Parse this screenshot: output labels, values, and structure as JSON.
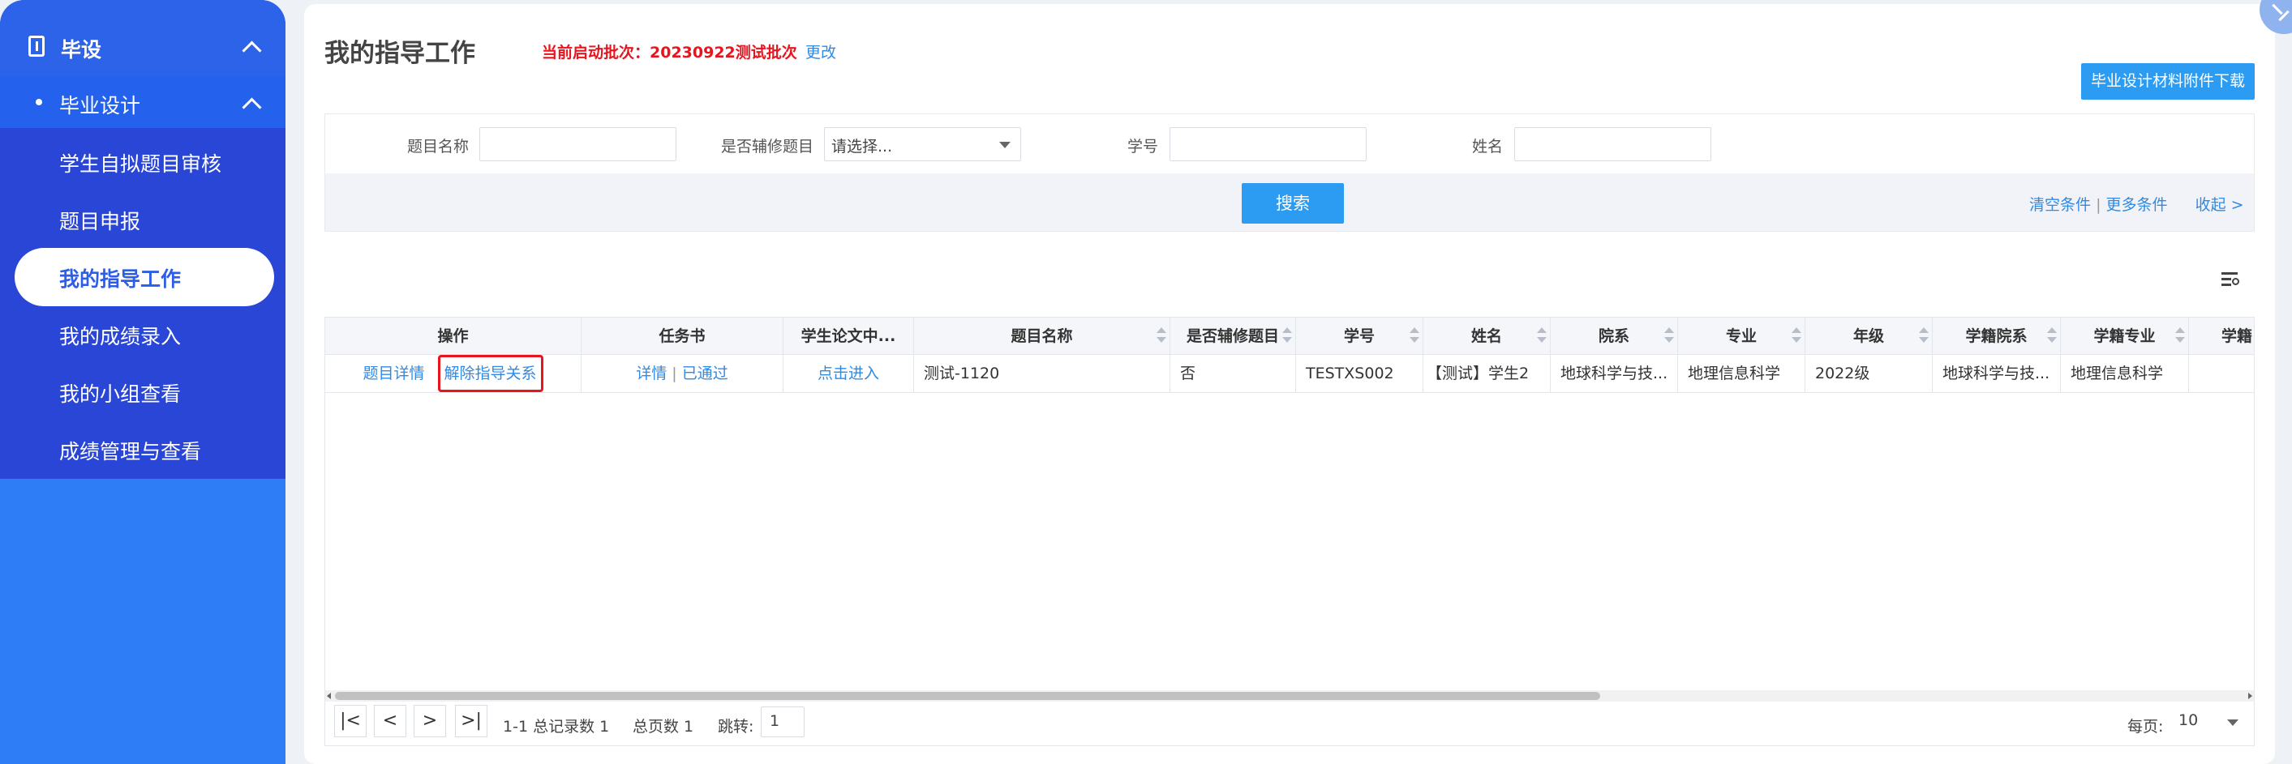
{
  "sidebar": {
    "title": "毕设",
    "section": "毕业设计",
    "items": [
      {
        "label": "学生自拟题目审核"
      },
      {
        "label": "题目申报"
      },
      {
        "label": "我的指导工作",
        "active": true
      },
      {
        "label": "我的成绩录入"
      },
      {
        "label": "我的小组查看"
      },
      {
        "label": "成绩管理与查看"
      }
    ]
  },
  "header": {
    "title": "我的指导工作",
    "batch_text": "当前启动批次：20230922测试批次",
    "change_link": "更改",
    "download_button": "毕业设计材料附件下载"
  },
  "search": {
    "topic_name_label": "题目名称",
    "topic_name_value": "",
    "minor_label": "是否辅修题目",
    "minor_placeholder": "请选择...",
    "student_no_label": "学号",
    "student_no_value": "",
    "name_label": "姓名",
    "name_value": "",
    "search_button": "搜索",
    "clear_link": "清空条件",
    "more_link": "更多条件",
    "collapse_link": "收起 >"
  },
  "table": {
    "columns": [
      "操作",
      "任务书",
      "学生论文中...",
      "题目名称",
      "是否辅修题目",
      "学号",
      "姓名",
      "院系",
      "专业",
      "年级",
      "学籍院系",
      "学籍专业",
      "学籍"
    ],
    "rows": [
      {
        "action_detail": "题目详情",
        "action_release": "解除指导关系",
        "task_detail": "详情",
        "task_status": "已通过",
        "thesis": "点击进入",
        "topic": "测试-1120",
        "minor": "否",
        "student_no": "TESTXS002",
        "name": "【测试】学生2",
        "department": "地球科学与技...",
        "major": "地理信息科学",
        "grade": "2022级",
        "reg_department": "地球科学与技...",
        "reg_major": "地理信息科学"
      }
    ]
  },
  "pagination": {
    "summary": "1-1 总记录数 1",
    "total_pages": "总页数 1",
    "jump_label": "跳转:",
    "jump_value": "1",
    "per_page_label": "每页:",
    "per_page_value": "10"
  },
  "colors": {
    "sidebar_bg": "#2f7df6",
    "sidebar_submenu": "#2a46d6",
    "accent_blue": "#2f8ae5",
    "batch_red": "#e8141e",
    "button_blue": "#2b9cf2",
    "highlight_border": "#e8141e"
  },
  "icons": {
    "sidebar_title": "document-icon",
    "expand": "chevron-up-icon",
    "column_settings": "column-settings-icon",
    "corner": "collapse-arrows-icon"
  }
}
